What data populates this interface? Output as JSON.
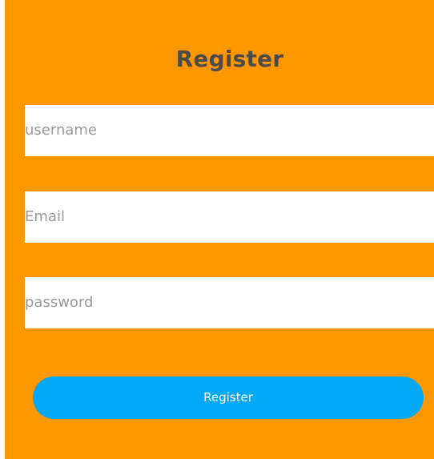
{
  "form": {
    "title": "Register",
    "fields": [
      {
        "name": "username",
        "placeholder": "username",
        "value": ""
      },
      {
        "name": "email",
        "placeholder": "Email",
        "value": ""
      },
      {
        "name": "password",
        "placeholder": "password",
        "value": ""
      }
    ],
    "submit_label": "Register"
  },
  "colors": {
    "background": "#ff9700",
    "field": "#ffffff",
    "button": "#03a9f4",
    "title_text": "#4b4b4b",
    "placeholder_text": "#9a9a9a"
  }
}
